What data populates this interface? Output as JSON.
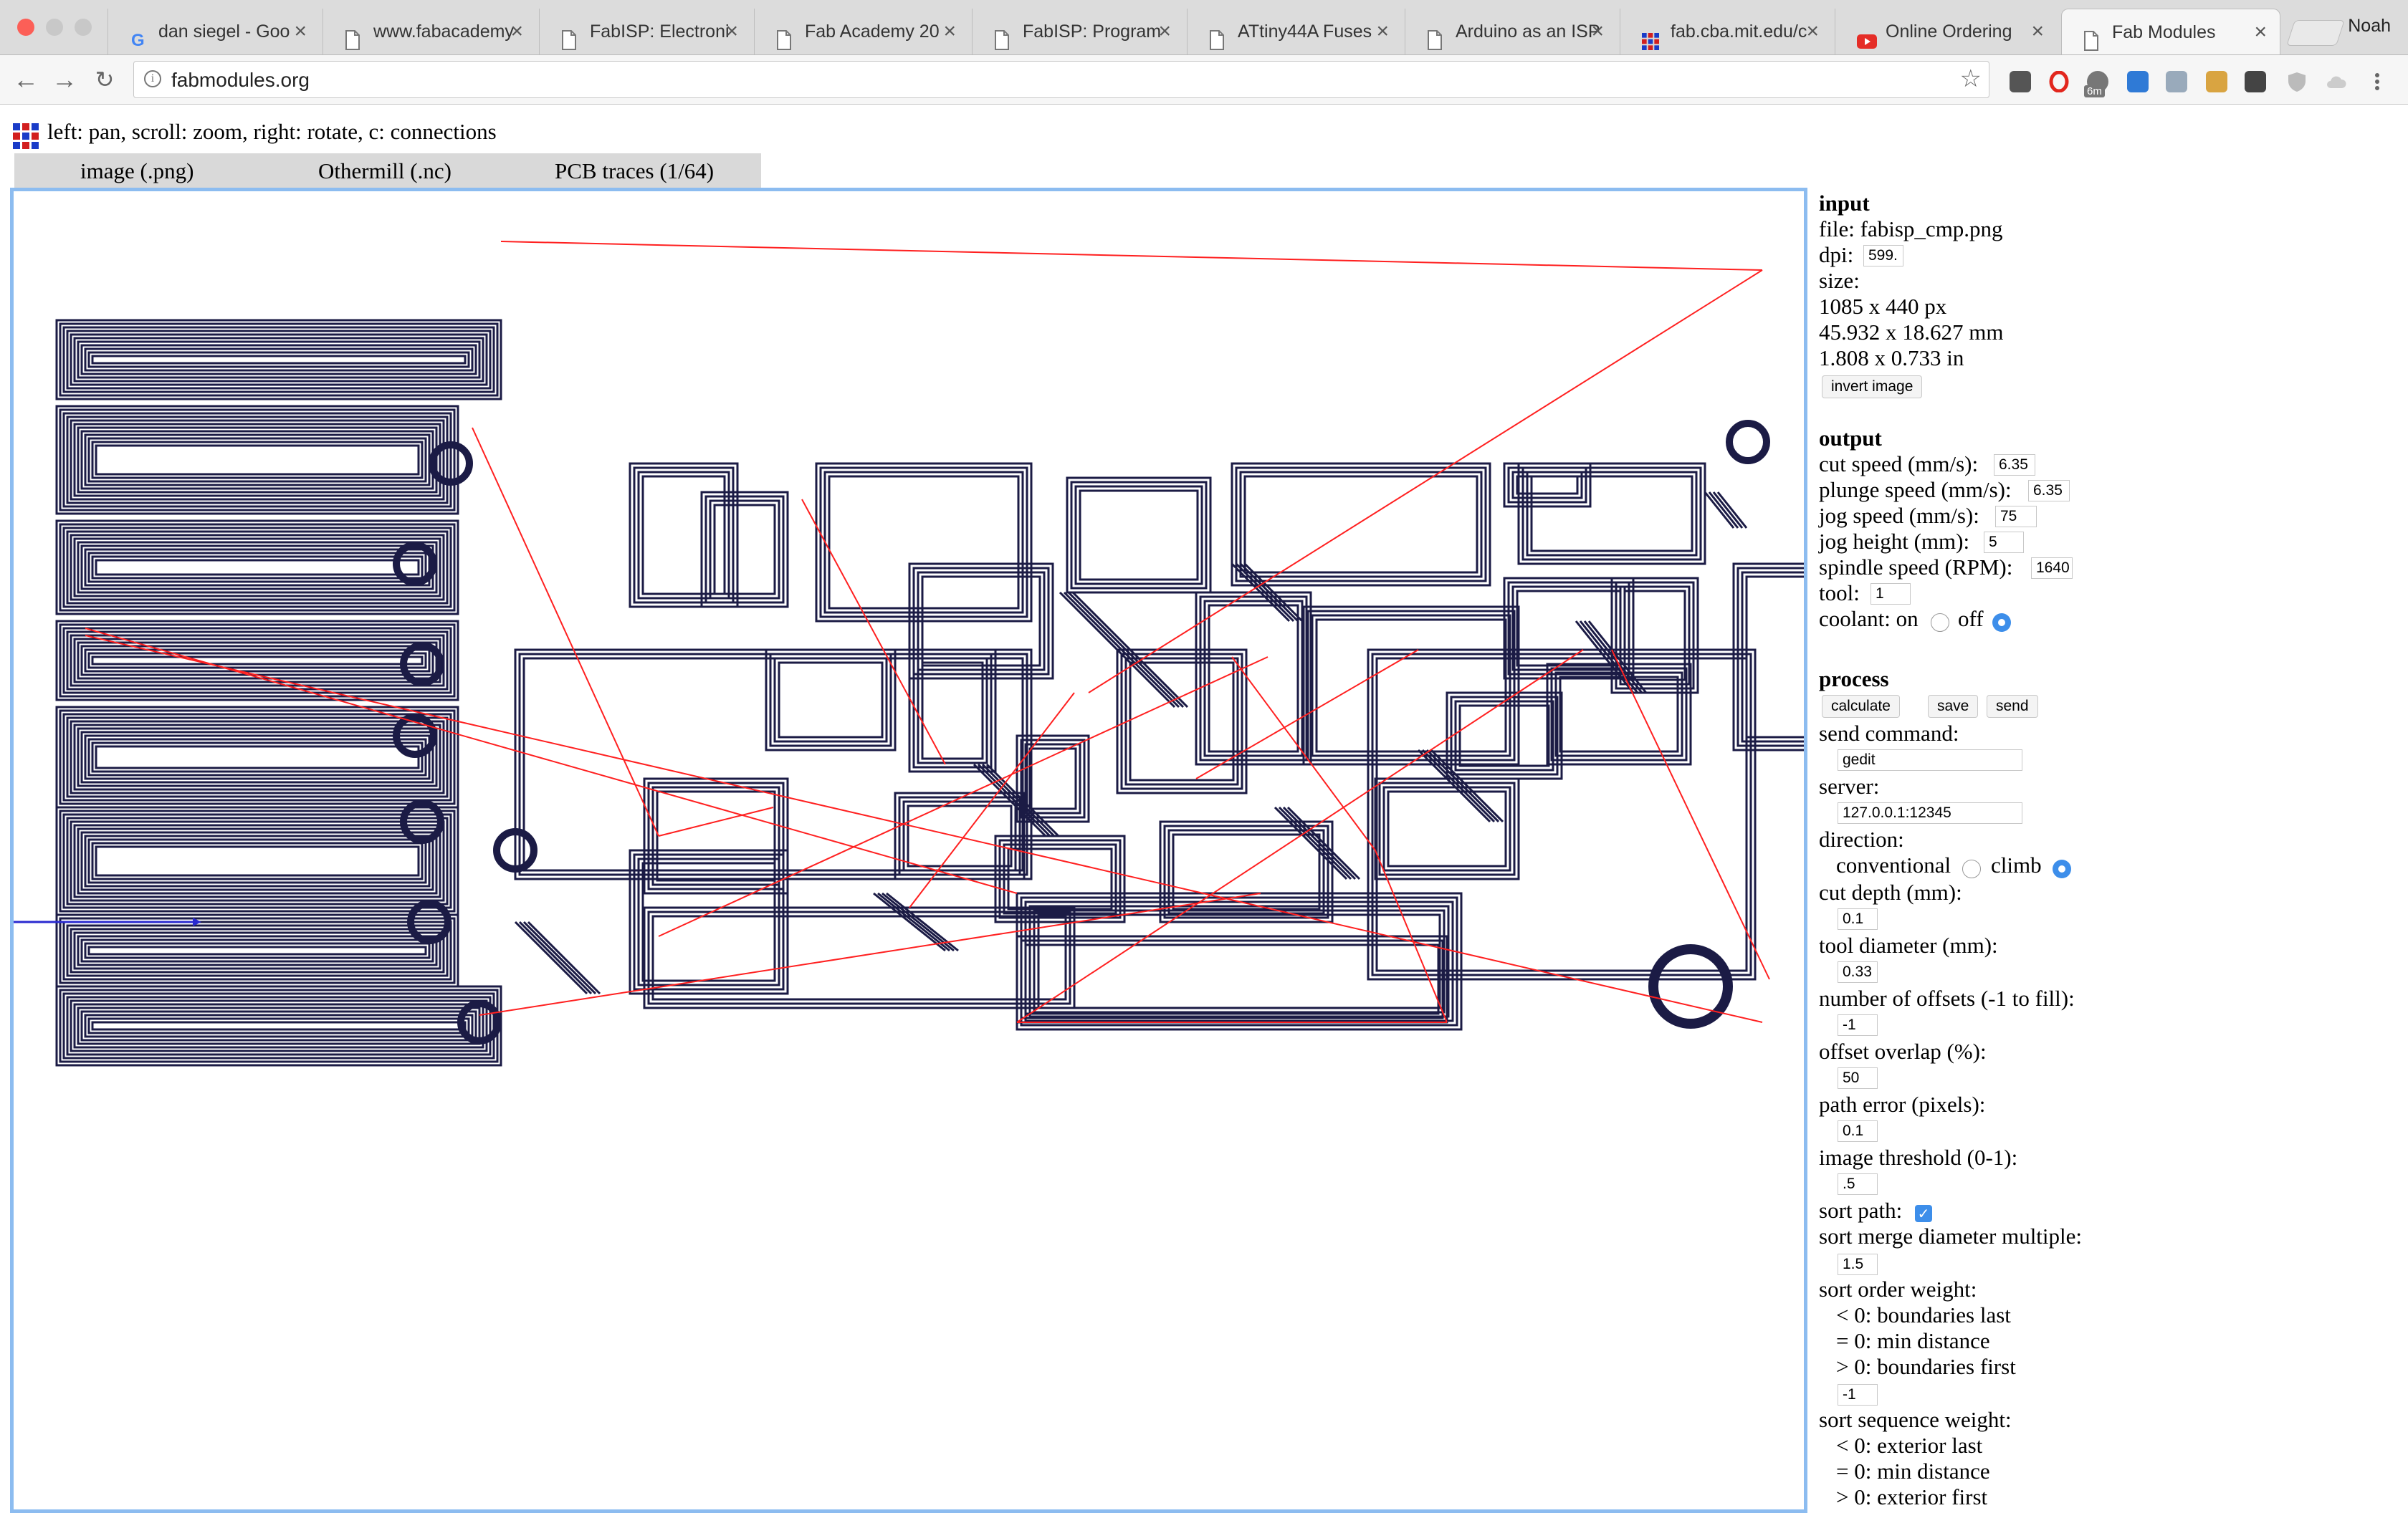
{
  "browser": {
    "tabs": [
      {
        "title": "dan siegel - Goo",
        "icon": "google-icon",
        "active": false
      },
      {
        "title": "www.fabacademy",
        "icon": "page-icon",
        "active": false
      },
      {
        "title": "FabISP: Electroni",
        "icon": "page-icon",
        "active": false
      },
      {
        "title": "Fab Academy 20",
        "icon": "page-icon",
        "active": false
      },
      {
        "title": "FabISP: Program",
        "icon": "page-icon",
        "active": false
      },
      {
        "title": "ATtiny44A Fuses",
        "icon": "page-icon",
        "active": false
      },
      {
        "title": "Arduino as an ISP",
        "icon": "page-icon",
        "active": false
      },
      {
        "title": "fab.cba.mit.edu/c",
        "icon": "fab-grid-icon",
        "active": false
      },
      {
        "title": "Online Ordering",
        "icon": "youtube-icon",
        "active": false
      },
      {
        "title": "Fab Modules",
        "icon": "page-icon",
        "active": true
      }
    ],
    "profile_name": "Noah",
    "url": "fabmodules.org",
    "extension_icons": [
      "pocket-icon",
      "opera-icon",
      "timer-icon",
      "trello-icon",
      "dropbox-icon",
      "face-icon",
      "evernote-icon",
      "shield-icon",
      "cloud-icon",
      "menu-icon"
    ],
    "timer_badge": "6m"
  },
  "app": {
    "help_text": "left: pan, scroll: zoom, right: rotate, c: connections",
    "formats": [
      "image (.png)",
      "Othermill (.nc)",
      "PCB traces (1/64)"
    ]
  },
  "panel": {
    "input": {
      "heading": "input",
      "file_label": "file: fabisp_cmp.png",
      "dpi_label": "dpi:",
      "dpi_value": "599.",
      "size_label": "size:",
      "size_px": "1085 x 440 px",
      "size_mm": "45.932 x 18.627 mm",
      "size_in": "1.808 x 0.733 in",
      "invert_button": "invert image"
    },
    "output": {
      "heading": "output",
      "cut_speed_label": "cut speed (mm/s):",
      "cut_speed": "6.35",
      "plunge_speed_label": "plunge speed (mm/s):",
      "plunge_speed": "6.35",
      "jog_speed_label": "jog speed (mm/s):",
      "jog_speed": "75",
      "jog_height_label": "jog height (mm):",
      "jog_height": "5",
      "spindle_speed_label": "spindle speed (RPM):",
      "spindle_speed": "1640",
      "tool_label": "tool:",
      "tool": "1",
      "coolant_label": "coolant: on",
      "coolant_off_label": "off",
      "coolant": "off"
    },
    "process": {
      "heading": "process",
      "calculate_button": "calculate",
      "save_button": "save",
      "send_button": "send",
      "send_command_label": "send command:",
      "send_command": "gedit",
      "server_label": "server:",
      "server": "127.0.0.1:12345",
      "direction_label": "direction:",
      "conventional_label": "conventional",
      "climb_label": "climb",
      "direction": "climb",
      "cut_depth_label": "cut depth (mm):",
      "cut_depth": "0.1",
      "tool_diameter_label": "tool diameter (mm):",
      "tool_diameter": "0.33",
      "offsets_label": "number of offsets (-1 to fill):",
      "offsets": "-1",
      "overlap_label": "offset overlap (%):",
      "overlap": "50",
      "path_error_label": "path error (pixels):",
      "path_error": "0.1",
      "threshold_label": "image threshold (0-1):",
      "threshold": ".5",
      "sort_path_label": "sort path:",
      "sort_path": true,
      "merge_label": "sort merge diameter multiple:",
      "merge": "1.5",
      "order_weight_label": "sort order weight:",
      "order_options": [
        "< 0: boundaries last",
        "= 0: min distance",
        "> 0: boundaries first"
      ],
      "order_weight": "-1",
      "sequence_weight_label": "sort sequence weight:",
      "sequence_options": [
        "< 0: exterior last",
        "= 0: min distance",
        "> 0: exterior first"
      ]
    }
  },
  "colors": {
    "trace": "#1b1b45",
    "jog": "#ff2020",
    "axis": "#2a2ad0",
    "accent": "#3d8eea"
  }
}
